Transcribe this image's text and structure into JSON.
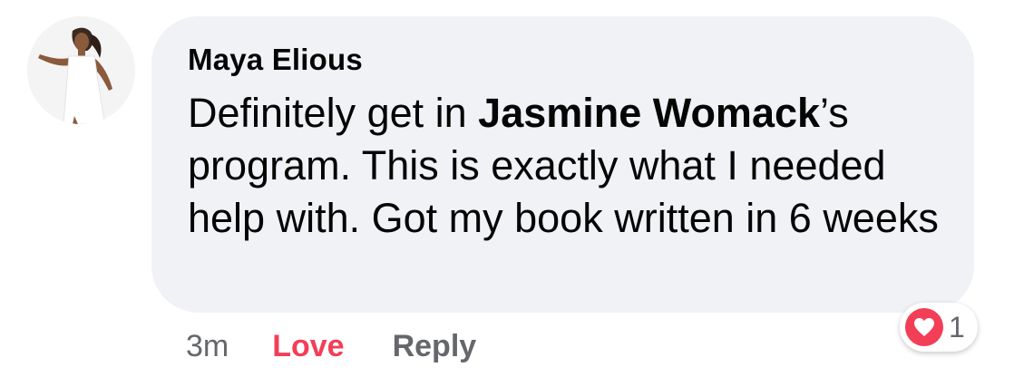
{
  "comment": {
    "author": "Maya Elious",
    "text_before": "Definitely get in ",
    "mention": "Jasmine Womack",
    "text_after": "’s program. This is exactly what I needed help with. Got my book written in 6 weeks"
  },
  "actions": {
    "time": "3m",
    "love_label": "Love",
    "reply_label": "Reply"
  },
  "reactions": {
    "icon": "heart-icon",
    "count": "1"
  },
  "colors": {
    "bubble": "#f0f2f5",
    "love": "#f33e58",
    "muted": "#65676b"
  }
}
